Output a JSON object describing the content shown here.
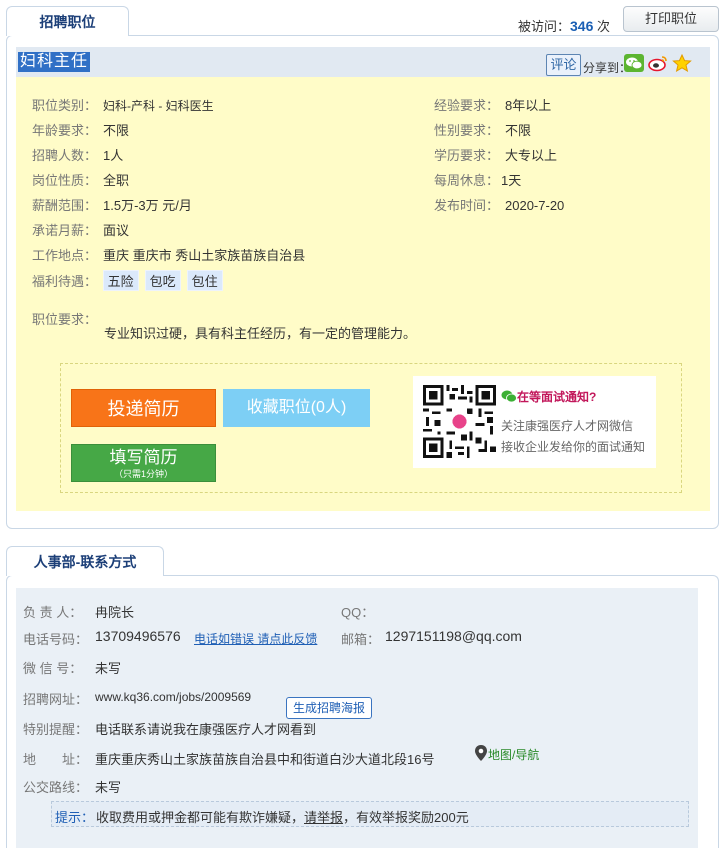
{
  "header": {
    "tab_label": "招聘职位",
    "visit_label": "被访问：",
    "visit_count": "346",
    "visit_unit": "次",
    "print_label": "打印职位"
  },
  "job": {
    "title": "妇科主任",
    "comment_label": "评论",
    "share_label": "分享到：",
    "share_icons": [
      "wechat-icon",
      "weibo-icon",
      "favorite-star-icon"
    ],
    "fields_left": [
      {
        "k": "职位类别：",
        "v": "妇科-产科 - 妇科医生"
      },
      {
        "k": "年龄要求：",
        "v": "不限"
      },
      {
        "k": "招聘人数：",
        "v": "1人"
      },
      {
        "k": "岗位性质：",
        "v": "全职"
      },
      {
        "k": "薪酬范围：",
        "v": "1.5万-3万 元/月"
      },
      {
        "k": "承诺月薪：",
        "v": "面议"
      },
      {
        "k": "工作地点：",
        "v": "重庆 重庆市 秀山土家族苗族自治县"
      },
      {
        "k": "福利待遇：",
        "v": ""
      }
    ],
    "fields_right": [
      {
        "k": "经验要求：",
        "v": "8年以上"
      },
      {
        "k": "性别要求：",
        "v": "不限"
      },
      {
        "k": "学历要求：",
        "v": "大专以上"
      },
      {
        "k": "每周休息：",
        "v": "1天"
      },
      {
        "k": "发布时间：",
        "v": "2020-7-20"
      }
    ],
    "welfare": [
      "五险",
      "包吃",
      "包住"
    ],
    "requirement_label": "职位要求：",
    "requirement_text": "专业知识过硬，具有科主任经历，有一定的管理能力。",
    "buttons": {
      "submit": "投递简历",
      "favorite": "收藏职位(0人)",
      "fill": "填写简历",
      "fill_sub": "（只需1分钟）"
    },
    "qr_card": {
      "heading": "在等面试通知?",
      "line1": "关注康强医疗人才网微信",
      "line2": "接收企业发给你的面试通知"
    }
  },
  "contact": {
    "tab_label": "人事部-联系方式",
    "person_label": "负 责 人：",
    "person": "冉院长",
    "qq_label": "QQ：",
    "phone_label": "电话号码：",
    "phone": "13709496576",
    "phone_feedback": "电话如错误 请点此反馈",
    "email_label": "邮箱：",
    "email": "1297151198@qq.com",
    "wechat_label": "微 信 号：",
    "wechat": "未写",
    "url_label": "招聘网址：",
    "url": "www.kq36.com/jobs/2009569",
    "poster_label": "生成招聘海报",
    "notice_label": "特别提醒：",
    "notice": "电话联系请说我在康强医疗人才网看到",
    "address_label": "地　　址：",
    "address": "重庆重庆秀山土家族苗族自治县中和街道白沙大道北段16号",
    "map_label": "地图/导航",
    "bus_label": "公交路线：",
    "bus": "未写",
    "tip_label": "提示：",
    "tip_pre": "收取费用或押金都可能有欺诈嫌疑，",
    "tip_link": "请举报",
    "tip_post": "，有效举报奖励200元"
  }
}
